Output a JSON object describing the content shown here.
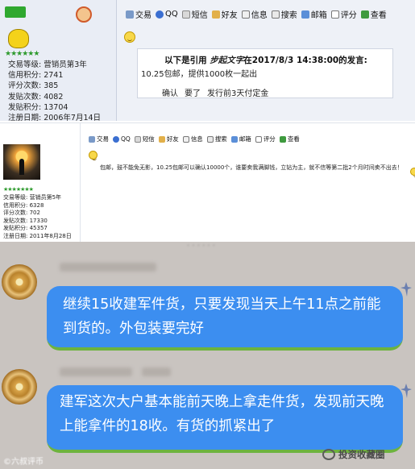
{
  "panel1": {
    "toolbar": [
      {
        "label": "交易",
        "icon": "trade-icon"
      },
      {
        "label": "QQ",
        "icon": "qq-icon"
      },
      {
        "label": "短信",
        "icon": "message-icon"
      },
      {
        "label": "好友",
        "icon": "friend-icon"
      },
      {
        "label": "信息",
        "icon": "info-icon"
      },
      {
        "label": "搜索",
        "icon": "search-icon"
      },
      {
        "label": "邮箱",
        "icon": "mail-icon"
      },
      {
        "label": "评分",
        "icon": "rate-icon"
      },
      {
        "label": "查看",
        "icon": "view-icon"
      }
    ],
    "profile": {
      "level": "交易等级: 营销员第3年",
      "credit": "信用积分: 2741",
      "ratings": "评分次数: 385",
      "posts": "发贴次数: 4082",
      "post_points": "发贴积分: 13704",
      "register": "注册日期: 2006年7月14日"
    },
    "quote": {
      "prefix": "以下是引用",
      "user": "步起文字",
      "suffix": "在2017/8/3 14:38:00的发言:",
      "body": "10.25包邮，提供1000枚一起出",
      "reply": [
        "确认",
        "要了",
        "发行前3天付定金"
      ]
    }
  },
  "panel2": {
    "toolbar": [
      {
        "label": "交易",
        "icon": "trade-icon"
      },
      {
        "label": "QQ",
        "icon": "qq-icon"
      },
      {
        "label": "短信",
        "icon": "message-icon"
      },
      {
        "label": "好友",
        "icon": "friend-icon"
      },
      {
        "label": "信息",
        "icon": "info-icon"
      },
      {
        "label": "搜索",
        "icon": "search-icon"
      },
      {
        "label": "邮箱",
        "icon": "mail-icon"
      },
      {
        "label": "评分",
        "icon": "rate-icon"
      },
      {
        "label": "查看",
        "icon": "view-icon"
      }
    ],
    "profile": {
      "level": "交易等级: 营销员第5年",
      "credit": "信用积分: 6328",
      "ratings": "评分次数: 702",
      "posts": "发贴次数: 17330",
      "post_points": "发贴积分: 45357",
      "register": "注册日期: 2011年8月28日"
    },
    "body": "包邮，鼓不能免无影，10.25包邮可以确认10000个，谁要卖我满脚钱，立钻为主，就不信等第二批2个月时间卖不出去！"
  },
  "chat": {
    "messages": [
      {
        "text": "继续15收建军件货，只要发现当天上午11点之前能到货的。外包装要完好"
      },
      {
        "text": "建军这次大户基本能前天晚上拿走件货，发现前天晚上能拿件的18收。有货的抓紧出了"
      }
    ],
    "watermark": "投资收藏圈",
    "corner_mark": "©六叔评币"
  },
  "colors": {
    "bubble": "#3c8ef0",
    "chat_bg": "#c9c4c0",
    "forum_bg": "#eef1f7"
  }
}
